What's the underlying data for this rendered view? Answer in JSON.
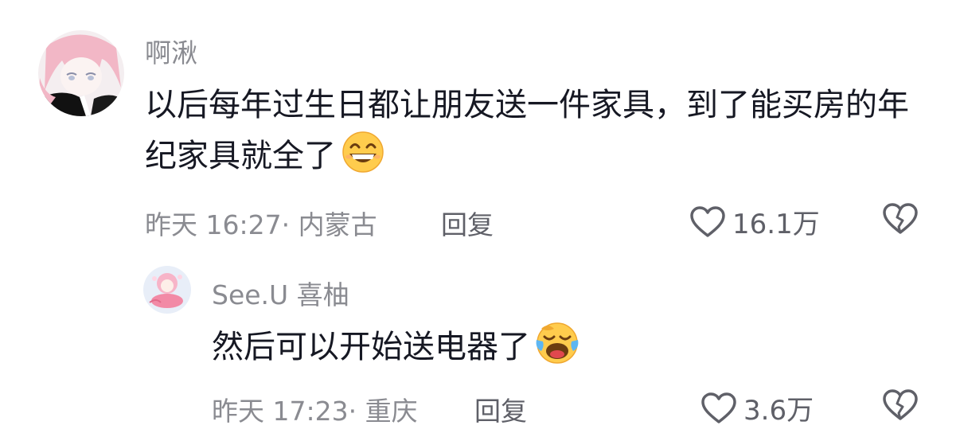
{
  "comments": [
    {
      "username": "啊湫",
      "text": "以后每年过生日都让朋友送一件家具，到了能买房的年纪家具就全了",
      "emoji": "grinning-face-emoji",
      "meta": "昨天 16:27· 内蒙古",
      "reply_label": "回复",
      "like_count": "16.1万",
      "avatar": "anime-girl-pink-hair-avatar"
    },
    {
      "username": "See.U 喜柚",
      "text": "然后可以开始送电器了",
      "emoji": "rolling-on-floor-laughing-emoji",
      "meta": "昨天 17:23· 重庆",
      "reply_label": "回复",
      "like_count": "3.6万",
      "avatar": "pink-character-avatar"
    }
  ],
  "icons": {
    "like": "heart-outline-icon",
    "dislike": "broken-heart-icon"
  },
  "colors": {
    "text_primary": "#161823",
    "text_secondary": "#8a8b91",
    "action": "#5f6068"
  }
}
